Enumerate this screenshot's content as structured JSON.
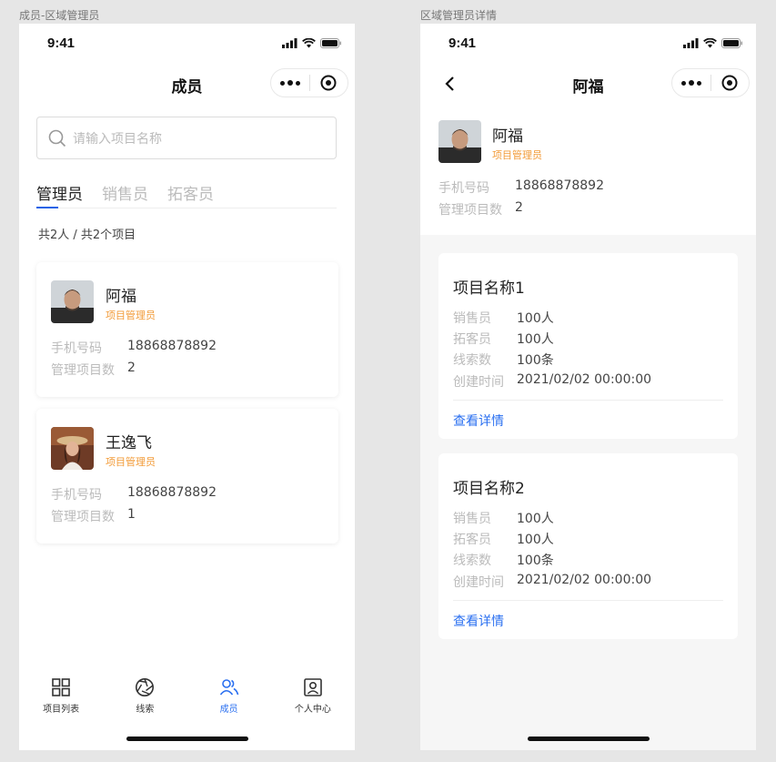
{
  "labels": {
    "left_frame": "成员-区域管理员",
    "right_frame": "区域管理员详情"
  },
  "status": {
    "time": "9:41"
  },
  "members_page": {
    "title": "成员",
    "search_placeholder": "请输入项目名称",
    "tabs": [
      {
        "label": "管理员",
        "active": true
      },
      {
        "label": "销售员",
        "active": false
      },
      {
        "label": "拓客员",
        "active": false
      }
    ],
    "summary": "共2人 / 共2个项目",
    "members": [
      {
        "name": "阿福",
        "role": "项目管理员",
        "phone_label": "手机号码",
        "phone": "18868878892",
        "count_label": "管理项目数",
        "count": "2"
      },
      {
        "name": "王逸飞",
        "role": "项目管理员",
        "phone_label": "手机号码",
        "phone": "18868878892",
        "count_label": "管理项目数",
        "count": "1"
      }
    ],
    "tabbar": [
      {
        "label": "项目列表",
        "icon": "grid-icon",
        "active": false
      },
      {
        "label": "线索",
        "icon": "aperture-icon",
        "active": false
      },
      {
        "label": "成员",
        "icon": "users-icon",
        "active": true
      },
      {
        "label": "个人中心",
        "icon": "profile-icon",
        "active": false
      }
    ]
  },
  "detail_page": {
    "title": "阿福",
    "name": "阿福",
    "role": "项目管理员",
    "phone_label": "手机号码",
    "phone": "18868878892",
    "count_label": "管理项目数",
    "count": "2",
    "projects": [
      {
        "title": "项目名称1",
        "rows": [
          {
            "label": "销售员",
            "value": "100人"
          },
          {
            "label": "拓客员",
            "value": "100人"
          },
          {
            "label": "线索数",
            "value": "100条"
          },
          {
            "label": "创建时间",
            "value": "2021/02/02 00:00:00"
          }
        ],
        "link": "查看详情"
      },
      {
        "title": "项目名称2",
        "rows": [
          {
            "label": "销售员",
            "value": "100人"
          },
          {
            "label": "拓客员",
            "value": "100人"
          },
          {
            "label": "线索数",
            "value": "100条"
          },
          {
            "label": "创建时间",
            "value": "2021/02/02 00:00:00"
          }
        ],
        "link": "查看详情"
      }
    ]
  },
  "colors": {
    "accent": "#2a6ff0",
    "role": "#f29b38",
    "tab_indicator": "#1f62e6"
  }
}
